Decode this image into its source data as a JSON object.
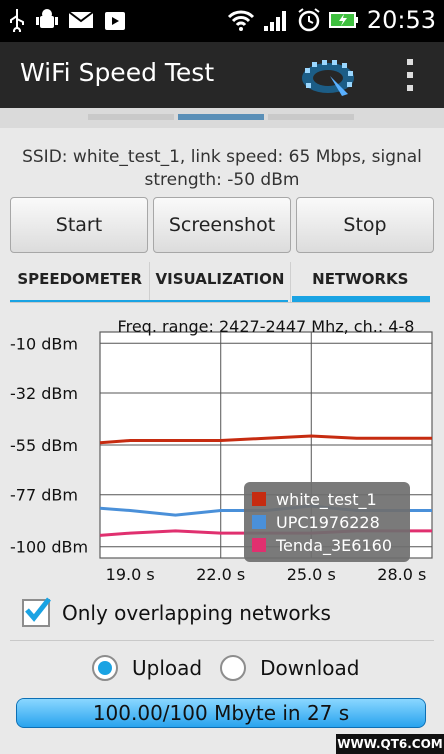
{
  "status_bar": {
    "time": "20:53",
    "icons": [
      "usb-icon",
      "android-debug-icon",
      "mail-icon",
      "play-store-icon",
      "wifi-icon",
      "signal-icon",
      "alarm-icon",
      "battery-charging-icon"
    ]
  },
  "app_bar": {
    "title": "WiFi Speed Test"
  },
  "ssid_text": "SSID: white_test_1, link speed: 65 Mbps, signal strength: -50 dBm",
  "buttons": {
    "start": "Start",
    "screenshot": "Screenshot",
    "stop": "Stop"
  },
  "tabs": [
    {
      "label": "SPEEDOMETER"
    },
    {
      "label": "VISUALIZATION"
    },
    {
      "label": "NETWORKS"
    }
  ],
  "chart_data": {
    "type": "line",
    "title": "Freq. range: 2427-2447 Mhz, ch.: 4-8",
    "y_ticks": [
      "-10 dBm",
      "-32 dBm",
      "-55 dBm",
      "-77 dBm",
      "-100 dBm"
    ],
    "x_ticks": [
      "19.0 s",
      "22.0 s",
      "25.0 s",
      "28.0 s"
    ],
    "xlim": [
      18.0,
      29.0
    ],
    "ylim": [
      -105,
      -5
    ],
    "series": [
      {
        "name": "white_test_1",
        "color": "#c62b10",
        "x": [
          18.0,
          19.0,
          20.5,
          22.0,
          23.5,
          25.0,
          26.5,
          28.0,
          29.0
        ],
        "y": [
          -54,
          -53,
          -53,
          -53,
          -52,
          -51,
          -52,
          -52,
          -52
        ]
      },
      {
        "name": "UPC1976228",
        "color": "#4a90d9",
        "x": [
          18.0,
          19.0,
          20.5,
          22.0,
          23.5,
          25.0,
          26.5,
          28.0,
          29.0
        ],
        "y": [
          -83,
          -84,
          -86,
          -84,
          -84,
          -82,
          -84,
          -84,
          -84
        ]
      },
      {
        "name": "Tenda_3E6160",
        "color": "#e0306f",
        "x": [
          18.0,
          19.0,
          20.5,
          22.0,
          23.5,
          25.0,
          26.5,
          28.0,
          29.0
        ],
        "y": [
          -95,
          -94,
          -93,
          -94,
          -94,
          -94,
          -93,
          -93,
          -93
        ]
      }
    ],
    "grid": true,
    "legend": "bottom-right"
  },
  "checkbox": {
    "label": "Only overlapping networks",
    "checked": true
  },
  "radios": {
    "upload": "Upload",
    "download": "Download",
    "selected": "upload"
  },
  "progress": {
    "text": "100.00/100 Mbyte in 27 s",
    "fraction": 1.0
  },
  "watermark": "WWW.QT6.COM"
}
